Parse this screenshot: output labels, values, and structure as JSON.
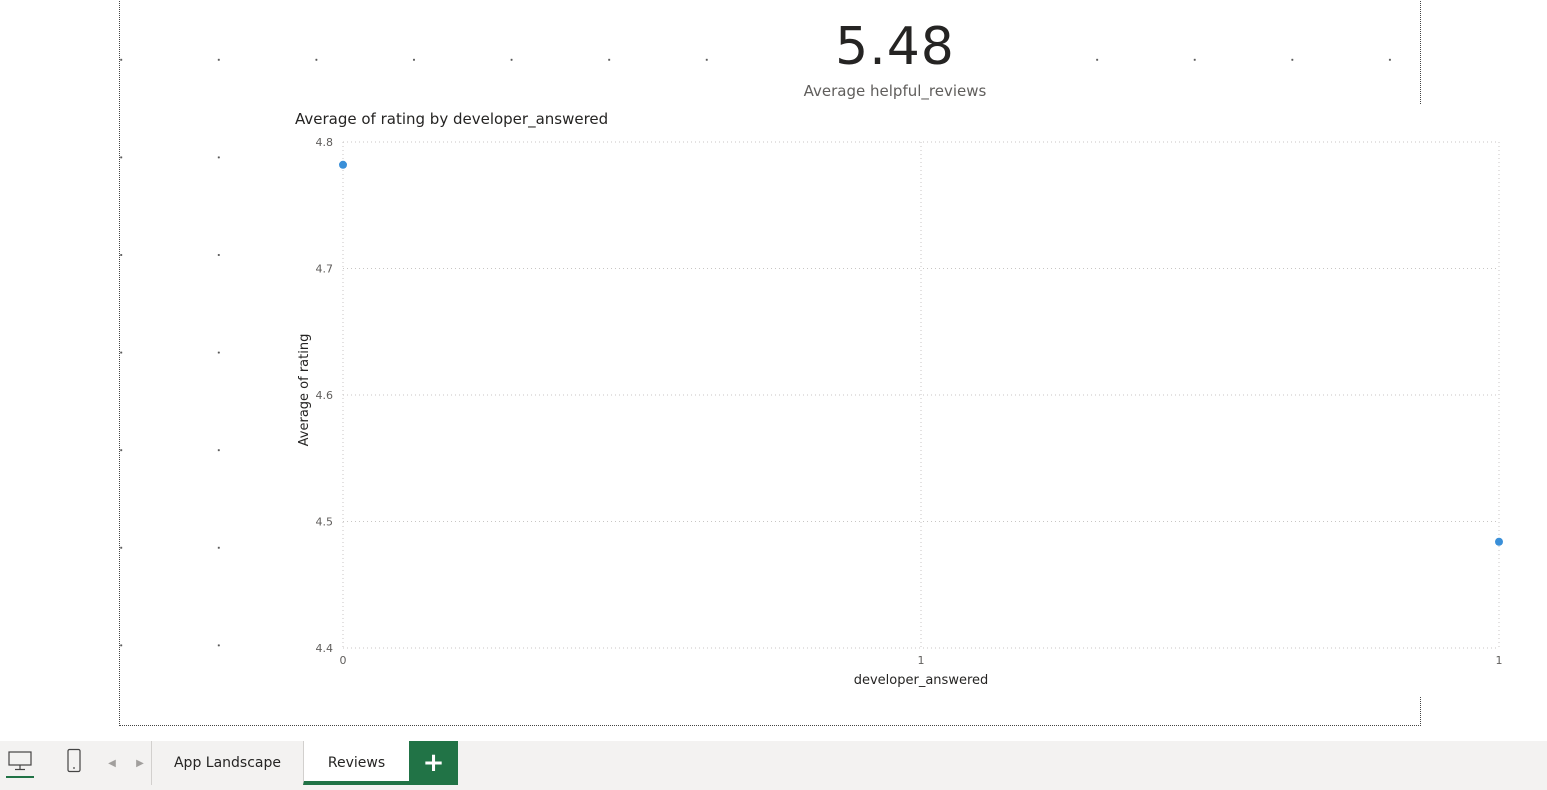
{
  "card": {
    "value": "5.48",
    "label": "Average helpful_reviews"
  },
  "chart_data": {
    "type": "scatter",
    "title": "Average of rating by developer_answered",
    "xlabel": "developer_answered",
    "ylabel": "Average of rating",
    "x_tick_labels": [
      "0",
      "1",
      "1"
    ],
    "y_tick_labels": [
      "4.8",
      "4.7",
      "4.6",
      "4.5",
      "4.4"
    ],
    "ylim": [
      4.4,
      4.8
    ],
    "xlim": [
      0,
      1
    ],
    "grid": true,
    "points": [
      {
        "x": 0,
        "y": 4.782
      },
      {
        "x": 1,
        "y": 4.484
      }
    ],
    "color": "#3a8fd8"
  },
  "page_bar": {
    "tabs": [
      {
        "label": "App Landscape"
      },
      {
        "label": "Reviews"
      }
    ],
    "add_label": "+",
    "prev_arrow": "◀",
    "next_arrow": "▶",
    "desktop_icon": "monitor-icon",
    "mobile_icon": "phone-icon",
    "accent": "#217346"
  }
}
